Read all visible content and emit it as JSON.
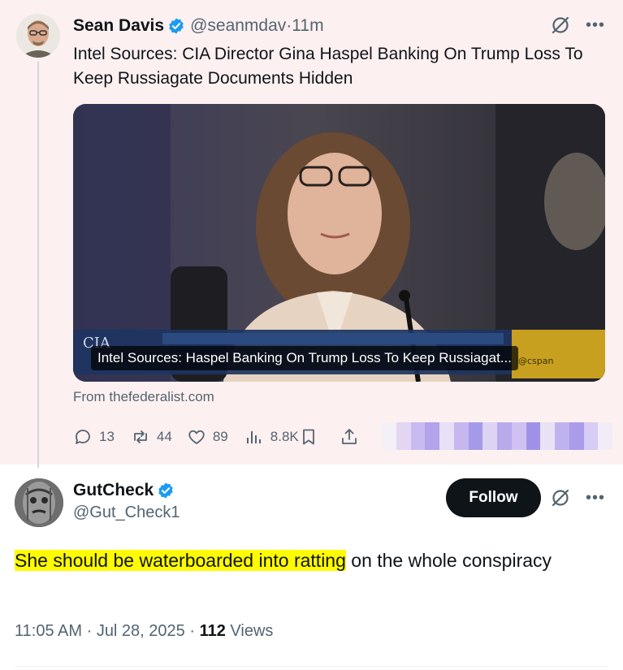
{
  "quoted_tweet": {
    "author_name": "Sean Davis",
    "author_handle": "@seanmdav",
    "time_separator": " · ",
    "time_ago": "11m",
    "text": "Intel Sources: CIA Director Gina Haspel Banking On Trump Loss To Keep Russiagate Documents Hidden",
    "link_card": {
      "caption": "Intel Sources: Haspel Banking On Trump Loss To Keep Russiagat...",
      "from_prefix": "From ",
      "domain": "thefederalist.com"
    },
    "metrics": {
      "replies": "13",
      "reposts": "44",
      "likes": "89",
      "views": "8.8K"
    }
  },
  "reply_tweet": {
    "author_name": "GutCheck",
    "author_handle": "@Gut_Check1",
    "follow_label": "Follow",
    "text_highlighted": "She should be waterboarded into ratting",
    "text_rest": " on the whole conspiracy",
    "time": "11:05 AM",
    "date": "Jul 28, 2025",
    "sep": " · ",
    "views_count": "112",
    "views_label": " Views"
  },
  "colors": {
    "verified_blue": "#1d9bf0",
    "highlight": "#fffb00",
    "muted_text": "#536471",
    "quote_bg": "#fdf0f0"
  },
  "icons": [
    "verified-badge-icon",
    "grok-icon",
    "more-icon",
    "reply-icon",
    "repost-icon",
    "like-icon",
    "views-icon",
    "bookmark-icon",
    "share-icon"
  ]
}
